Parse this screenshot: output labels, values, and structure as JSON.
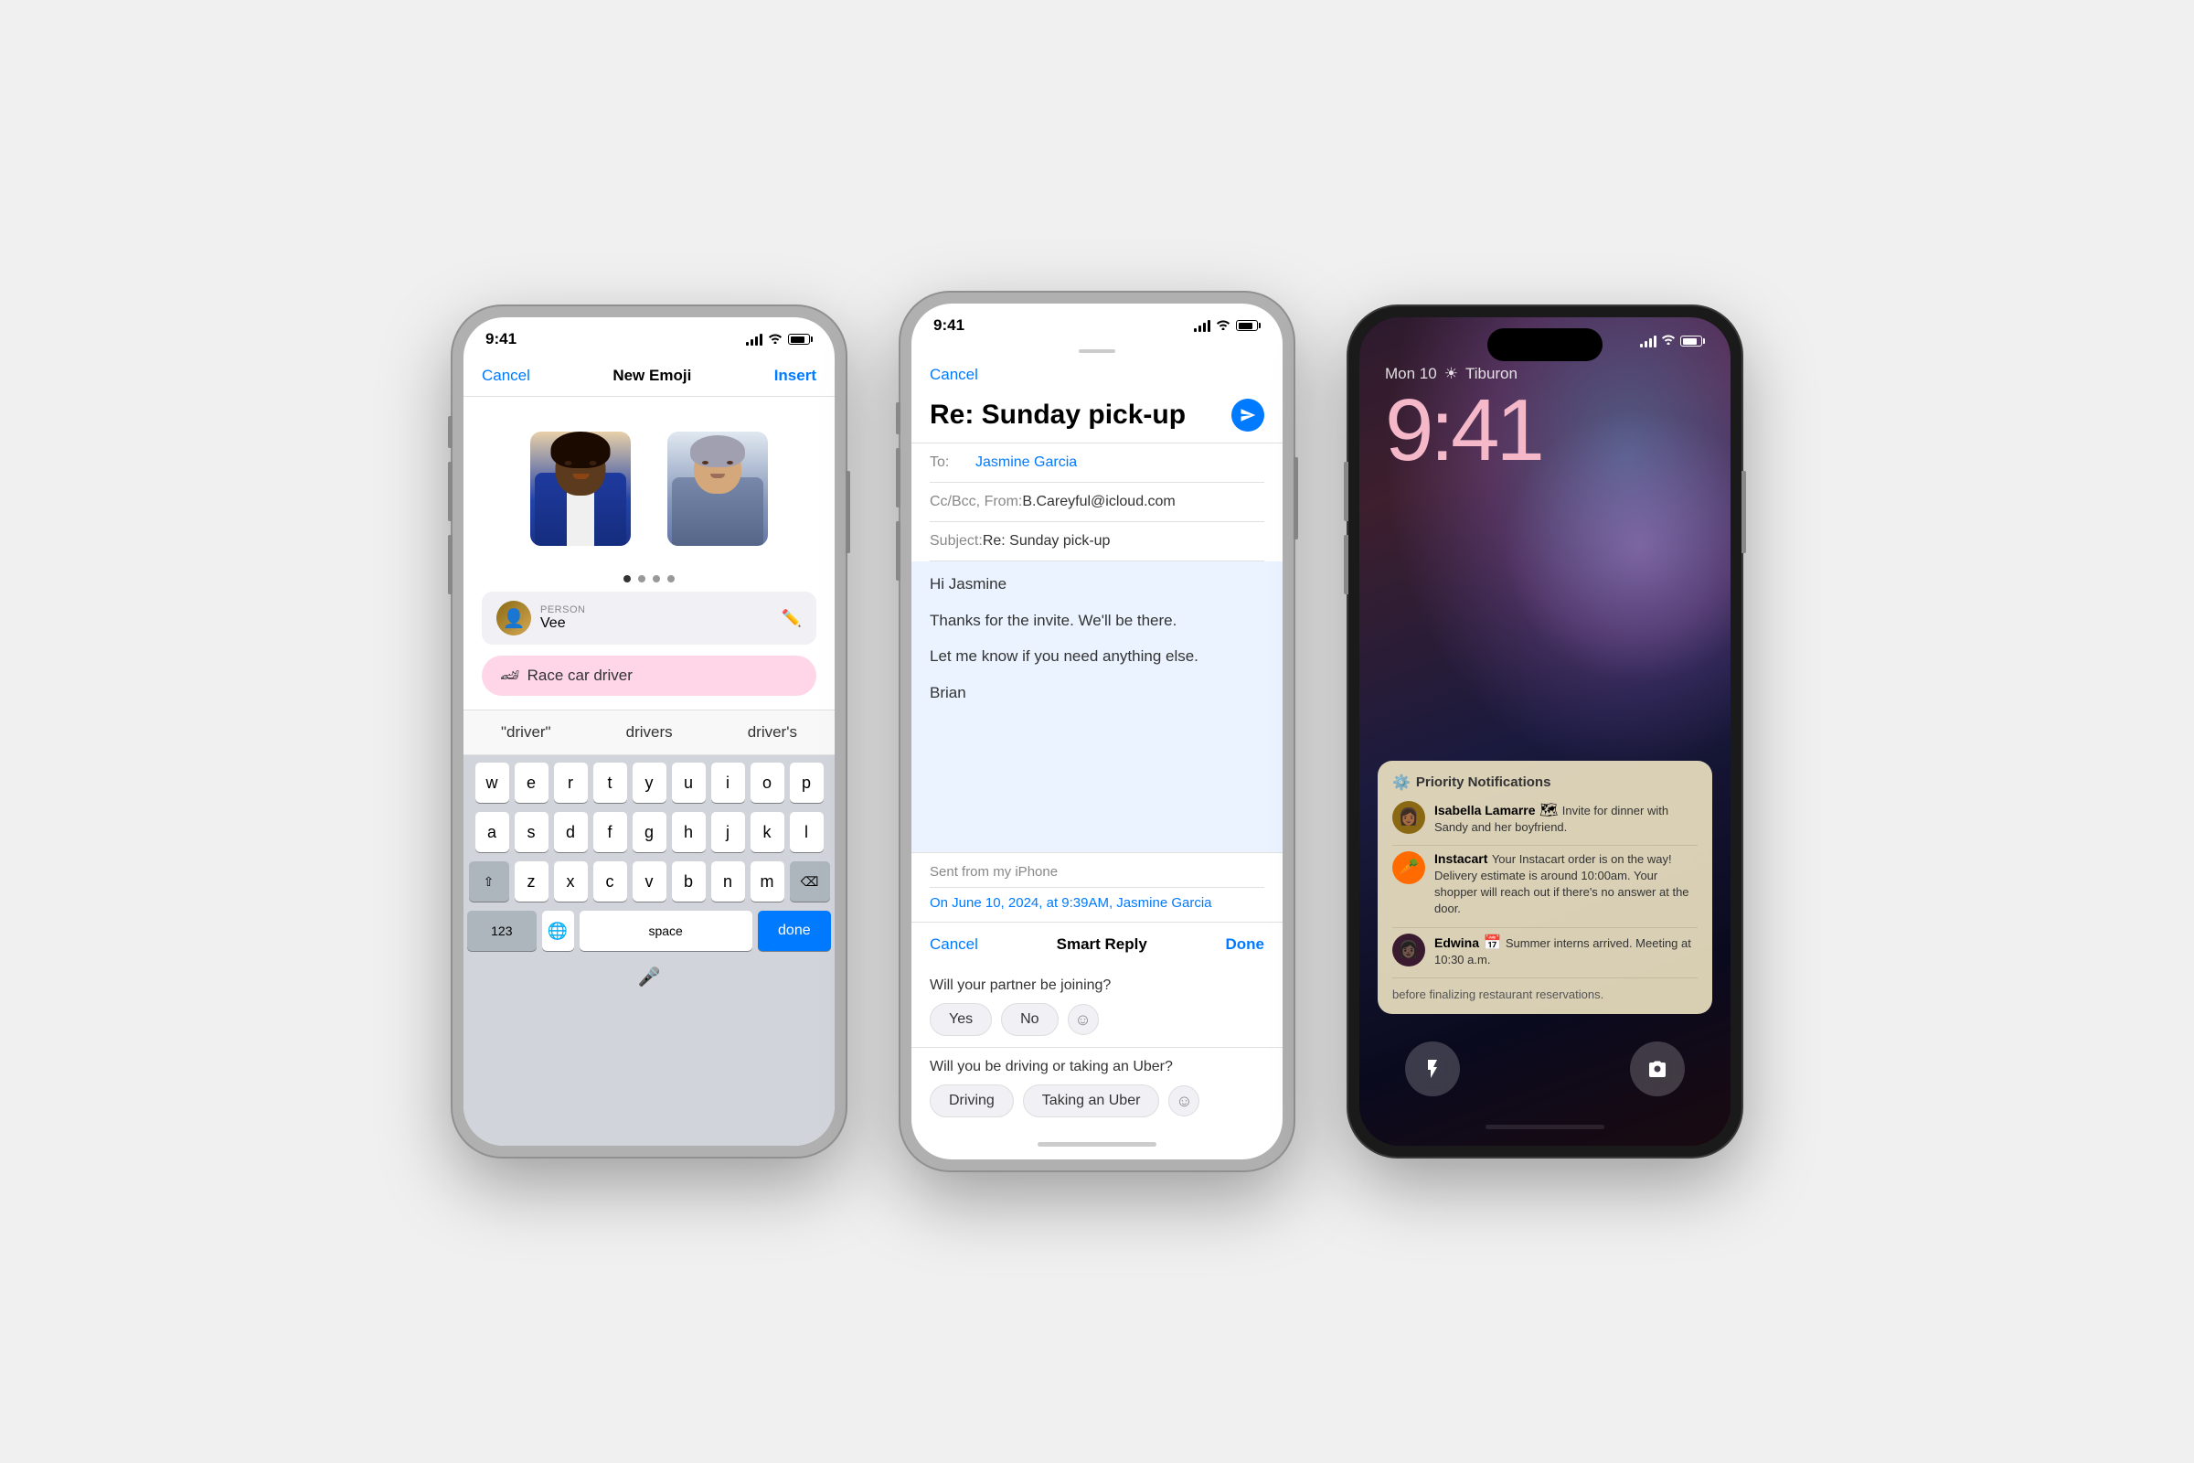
{
  "phones": {
    "phone1": {
      "status_time": "9:41",
      "nav": {
        "cancel": "Cancel",
        "title": "New Emoji",
        "insert": "Insert"
      },
      "avatars": [
        {
          "emoji": "👩🏾",
          "label": "avatar1"
        },
        {
          "emoji": "🧑🏼‍💼",
          "label": "avatar2"
        }
      ],
      "dots": [
        true,
        false,
        false,
        false
      ],
      "person_tag": "PERSON",
      "person_name": "Vee",
      "search_text": "Race car driver",
      "predictive": [
        {
          "text": "\"driver\"",
          "type": "quoted"
        },
        {
          "text": "drivers",
          "type": "normal"
        },
        {
          "text": "driver's",
          "type": "normal"
        }
      ],
      "keyboard_rows": [
        [
          "w",
          "e",
          "r",
          "t",
          "y",
          "u",
          "i",
          "o",
          "p"
        ],
        [
          "a",
          "s",
          "d",
          "f",
          "g",
          "h",
          "j",
          "k",
          "l"
        ],
        [
          "z",
          "x",
          "c",
          "v",
          "b",
          "n",
          "m"
        ]
      ],
      "key_123": "123",
      "key_space": "space",
      "key_done": "done"
    },
    "phone2": {
      "status_time": "9:41",
      "drag_handle": true,
      "cancel": "Cancel",
      "subject": "Re: Sunday pick-up",
      "to_label": "To:",
      "to_value": "Jasmine Garcia",
      "cc_label": "Cc/Bcc, From:",
      "cc_value": "B.Careyful@icloud.com",
      "subject_label": "Subject:",
      "subject_value": "Re: Sunday pick-up",
      "body": {
        "greeting": "Hi Jasmine",
        "line1": "Thanks for the invite. We'll be there.",
        "line2": "Let me know if you need anything else.",
        "signature": "Brian",
        "sent_from": "Sent from my iPhone",
        "original": "On June 10, 2024, at 9:39AM, Jasmine Garcia"
      },
      "smart_reply": {
        "cancel": "Cancel",
        "title": "Smart Reply",
        "done": "Done",
        "q1": "Will your partner be joining?",
        "q1_options": [
          "Yes",
          "No"
        ],
        "q2": "Will you be driving or taking an Uber?",
        "q2_options": [
          "Driving",
          "Taking an Uber"
        ]
      }
    },
    "phone3": {
      "status_time": "9:41",
      "date_weather": "Mon 10",
      "weather_icon": "☀",
      "location": "Tiburon",
      "time": "9:41",
      "priority_title": "Priority Notifications",
      "notifications": [
        {
          "sender": "Isabella Lamarre",
          "icon_emoji": "👩🏾",
          "text": "Invite for dinner with Sandy and her boyfriend."
        },
        {
          "sender": "Instacart",
          "icon_emoji": "🥕",
          "text": "Your Instacart order is on the way! Delivery estimate is around 10:00am. Your shopper will reach out if there's no answer at the door."
        },
        {
          "sender": "Edwina",
          "icon_emoji": "👩🏿",
          "text": "Summer interns arrived. Meeting at 10:30 a.m."
        }
      ],
      "more_text": "before finalizing restaurant reservations.",
      "flashlight_icon": "🔦",
      "camera_icon": "📷"
    }
  }
}
